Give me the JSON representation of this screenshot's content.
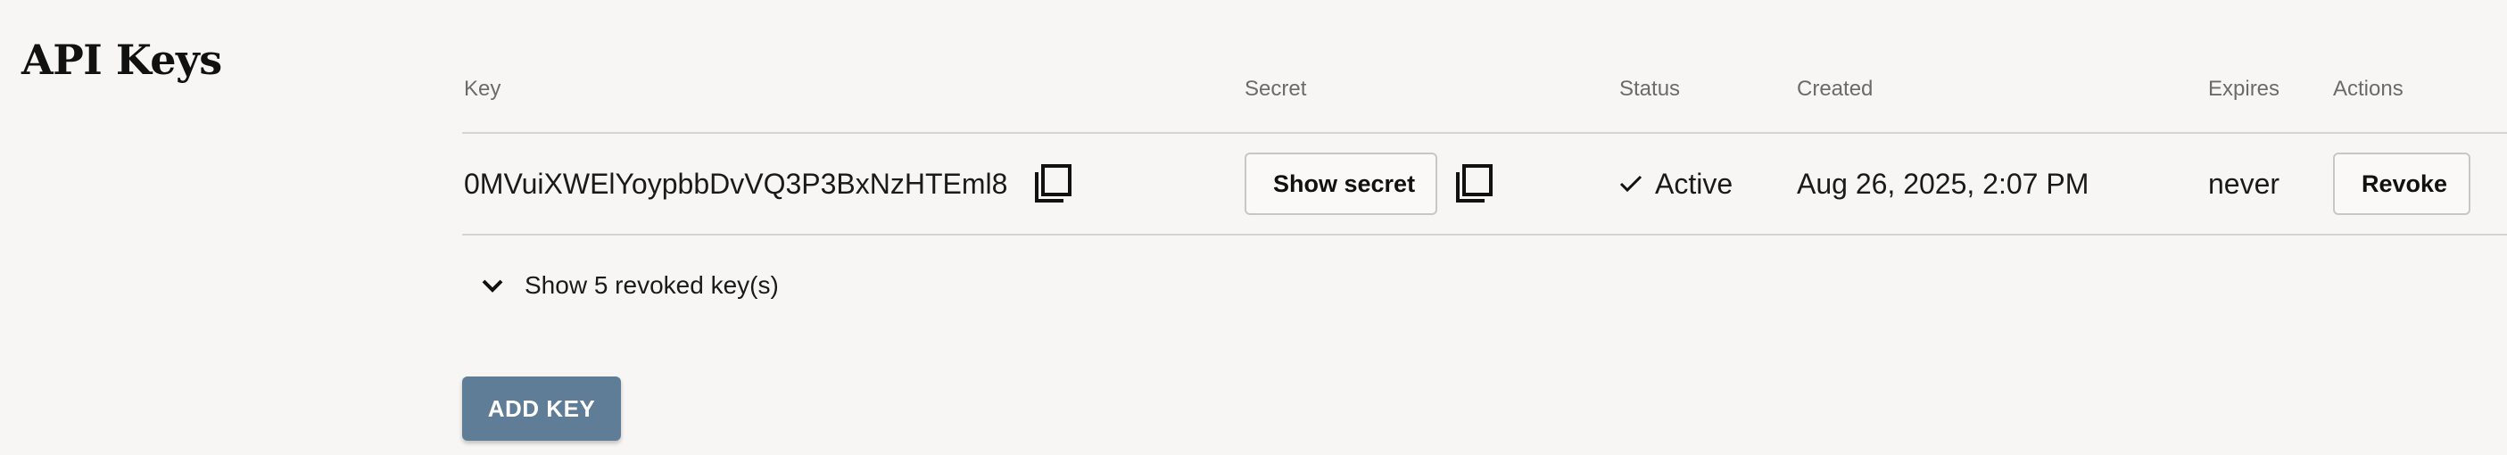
{
  "page": {
    "title": "API Keys"
  },
  "table": {
    "headers": {
      "key": "Key",
      "secret": "Secret",
      "status": "Status",
      "created": "Created",
      "expires": "Expires",
      "actions": "Actions"
    },
    "rows": [
      {
        "key": "0MVuiXWElYoypbbDvVQ3P3BxNzHTEml8",
        "secret_button": "Show secret",
        "status": "Active",
        "created": "Aug 26, 2025, 2:07 PM",
        "expires": "never",
        "action_button": "Revoke"
      }
    ]
  },
  "revoked": {
    "toggle_label": "Show 5 revoked key(s)"
  },
  "add_key": {
    "label": "ADD KEY"
  },
  "icons": {
    "copy": "copy-icon",
    "check": "check-icon",
    "chevron": "chevron-down-icon"
  },
  "colors": {
    "background": "#f7f6f4",
    "primary_button": "#5f7d96",
    "divider": "#d6d4d0"
  }
}
